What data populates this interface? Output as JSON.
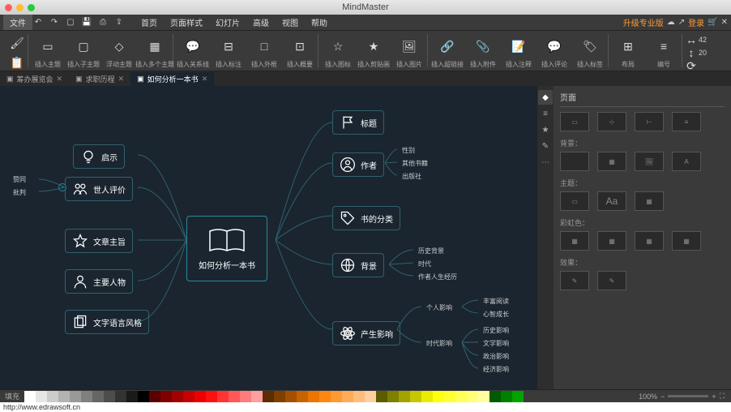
{
  "app_title": "MindMaster",
  "menu": {
    "file": "文件",
    "items": [
      "首页",
      "页面样式",
      "幻灯片",
      "高级",
      "视图",
      "帮助"
    ]
  },
  "upgrade": "升级专业版",
  "login": "登录",
  "ribbon": {
    "g1": [
      "插入主题",
      "插入子主题",
      "浮动主题",
      "插入多个主题"
    ],
    "g2": [
      "插入关系线",
      "插入标注",
      "插入外框",
      "插入概要"
    ],
    "g3": [
      "插入图标",
      "插入剪贴画",
      "插入图片"
    ],
    "g4": [
      "插入超链接",
      "插入附件",
      "插入注释",
      "插入评论",
      "插入标签"
    ],
    "g5": [
      "布局",
      "编号"
    ],
    "n1": "42",
    "n2": "20"
  },
  "tabs": [
    {
      "label": "筹办展览会",
      "active": false
    },
    {
      "label": "求职历程",
      "active": false
    },
    {
      "label": "如何分析一本书",
      "active": true
    }
  ],
  "center": "如何分析一本书",
  "left_nodes": [
    "启示",
    "世人评价",
    "文章主旨",
    "主要人物",
    "文字语言风格"
  ],
  "left_sub": [
    "赞同",
    "批判"
  ],
  "right_nodes": [
    "标题",
    "作者",
    "书的分类",
    "背景",
    "产生影响"
  ],
  "author_sub": [
    "性别",
    "其他书籍",
    "出版社"
  ],
  "bg_sub": [
    "历史背景",
    "时代",
    "作者人生经历"
  ],
  "impact_sub": [
    "个人影响",
    "时代影响"
  ],
  "personal_sub": [
    "丰富阅读",
    "心智成长"
  ],
  "era_sub": [
    "历史影响",
    "文学影响",
    "政治影响",
    "经济影响"
  ],
  "side": {
    "title": "页面",
    "s1": "背景：",
    "s2": "主题：",
    "s3": "彩虹色：",
    "s4": "效果："
  },
  "status": {
    "fill": "填充",
    "url": "http://www.edrawsoft.cn",
    "zoom": "100%"
  },
  "colors": [
    "#ffffff",
    "#e6e6e6",
    "#cccccc",
    "#b3b3b3",
    "#999999",
    "#808080",
    "#666666",
    "#4d4d4d",
    "#333333",
    "#1a1a1a",
    "#000000",
    "#5b0000",
    "#7f0000",
    "#a30000",
    "#c70000",
    "#eb0000",
    "#ff1010",
    "#ff3434",
    "#ff5858",
    "#ff7c7c",
    "#ffa0a0",
    "#5b2d00",
    "#7f3f00",
    "#a35100",
    "#c76300",
    "#eb7500",
    "#ff8710",
    "#ff9934",
    "#ffab58",
    "#ffbd7c",
    "#ffcfa0",
    "#5b5b00",
    "#7f7f00",
    "#a3a300",
    "#c7c700",
    "#ebeb00",
    "#ffff10",
    "#ffff34",
    "#ffff58",
    "#ffff7c",
    "#ffffa0",
    "#005b00",
    "#007f00",
    "#00a300",
    "#00c700",
    "#00eb00",
    "#10ff10",
    "#34ff34",
    "#58ff58",
    "#7cff7c",
    "#a0ffa0",
    "#005b5b",
    "#007f7f",
    "#00a3a3",
    "#00c7c7",
    "#00ebeb",
    "#10ffff",
    "#34ffff",
    "#58ffff",
    "#7cffff",
    "#a0ffff",
    "#00005b",
    "#00007f",
    "#0000a3",
    "#0000c7",
    "#0000eb",
    "#1010ff",
    "#3434ff",
    "#5858ff",
    "#7c7cff",
    "#a0a0ff",
    "#5b005b",
    "#7f007f",
    "#a30000a3",
    "#c700c7",
    "#eb00eb",
    "#ff10ff",
    "#ff34ff",
    "#ff58ff",
    "#ff7cff",
    "#ffa0ff"
  ]
}
